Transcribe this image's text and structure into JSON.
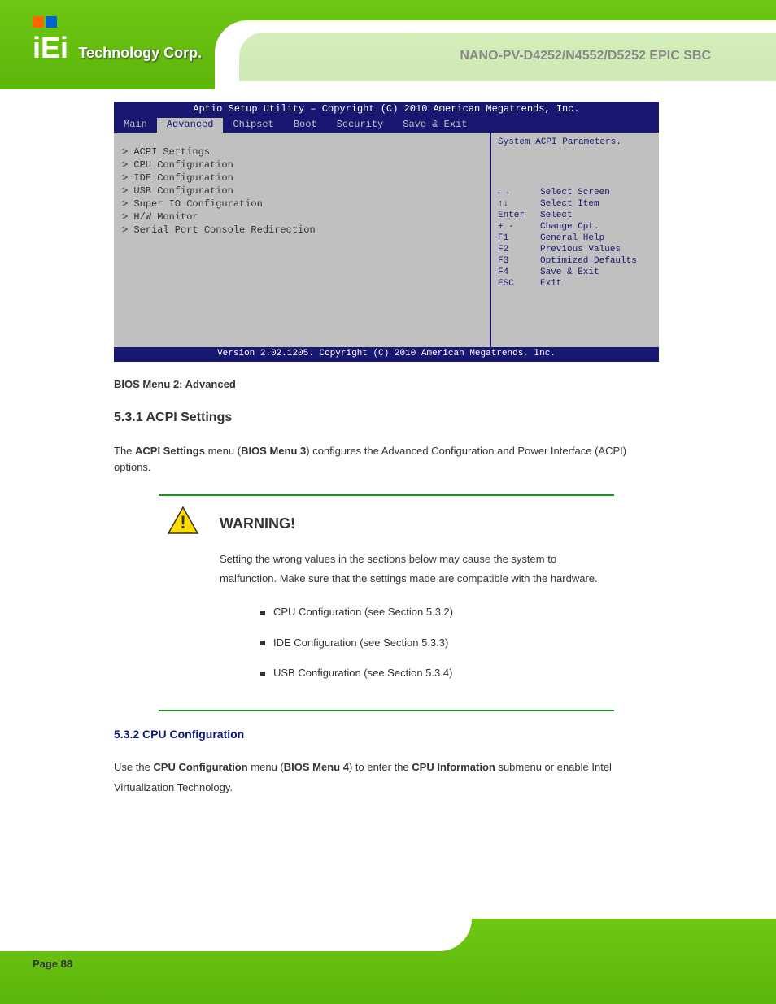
{
  "header": {
    "logo_text": "Technology Corp.",
    "doc_title": "NANO-PV-D4252/N4552/D5252 EPIC SBC"
  },
  "bios": {
    "title": "Aptio Setup Utility – Copyright (C) 2010 American Megatrends, Inc.",
    "tabs": [
      "Main",
      "Advanced",
      "Chipset",
      "Boot",
      "Security",
      "Save & Exit"
    ],
    "active_tab": "Advanced",
    "menu_items": [
      "> ACPI Settings",
      "> CPU Configuration",
      "> IDE Configuration",
      "> USB Configuration",
      "> Super IO Configuration",
      "> H/W Monitor",
      "> Serial Port Console Redirection"
    ],
    "help_nav": [
      {
        "keys": "←→",
        "desc": "Select Screen"
      },
      {
        "keys": "↑↓",
        "desc": "Select Item"
      },
      {
        "keys": "Enter",
        "desc": "Select"
      },
      {
        "keys": "+ -",
        "desc": "Change Opt."
      },
      {
        "keys": "F1",
        "desc": "General Help"
      },
      {
        "keys": "F2",
        "desc": "Previous Values"
      },
      {
        "keys": "F3",
        "desc": "Optimized Defaults"
      },
      {
        "keys": "F4",
        "desc": "Save & Exit"
      },
      {
        "keys": "ESC",
        "desc": "Exit"
      }
    ],
    "help_text": "System ACPI Parameters.",
    "footer": "Version 2.02.1205. Copyright (C) 2010 American Megatrends, Inc.",
    "menu_label": "BIOS Menu 2: Advanced"
  },
  "section": {
    "heading_number": "5.3.1",
    "heading_title": "ACPI Settings",
    "text_part1": "The ",
    "text_bold": "ACPI Settings",
    "text_part2": " menu (",
    "text_figure_ref": "BIOS Menu 3",
    "text_part3": ") configures the Advanced Configuration and Power Interface (ACPI) options."
  },
  "warning": {
    "title": "WARNING!",
    "intro": "Setting the wrong values in the sections below may cause the system to malfunction. Make sure that the settings made are compatible with the hardware.",
    "list": [
      "CPU Configuration (see Section 5.3.2)",
      "IDE Configuration (see Section 5.3.3)",
      "USB Configuration (see Section 5.3.4)"
    ]
  },
  "cpu": {
    "heading_number": "5.3.2",
    "heading_title": "CPU Configuration",
    "text_part1": "Use the ",
    "text_bold": "CPU Configuration",
    "text_part2": " menu (",
    "text_figure_ref": "BIOS Menu 4",
    "text_part3": ") to enter the ",
    "text_bold2": "CPU Information",
    "text_part4": " submenu or enable Intel Virtualization Technology."
  },
  "page_number": "Page 88"
}
